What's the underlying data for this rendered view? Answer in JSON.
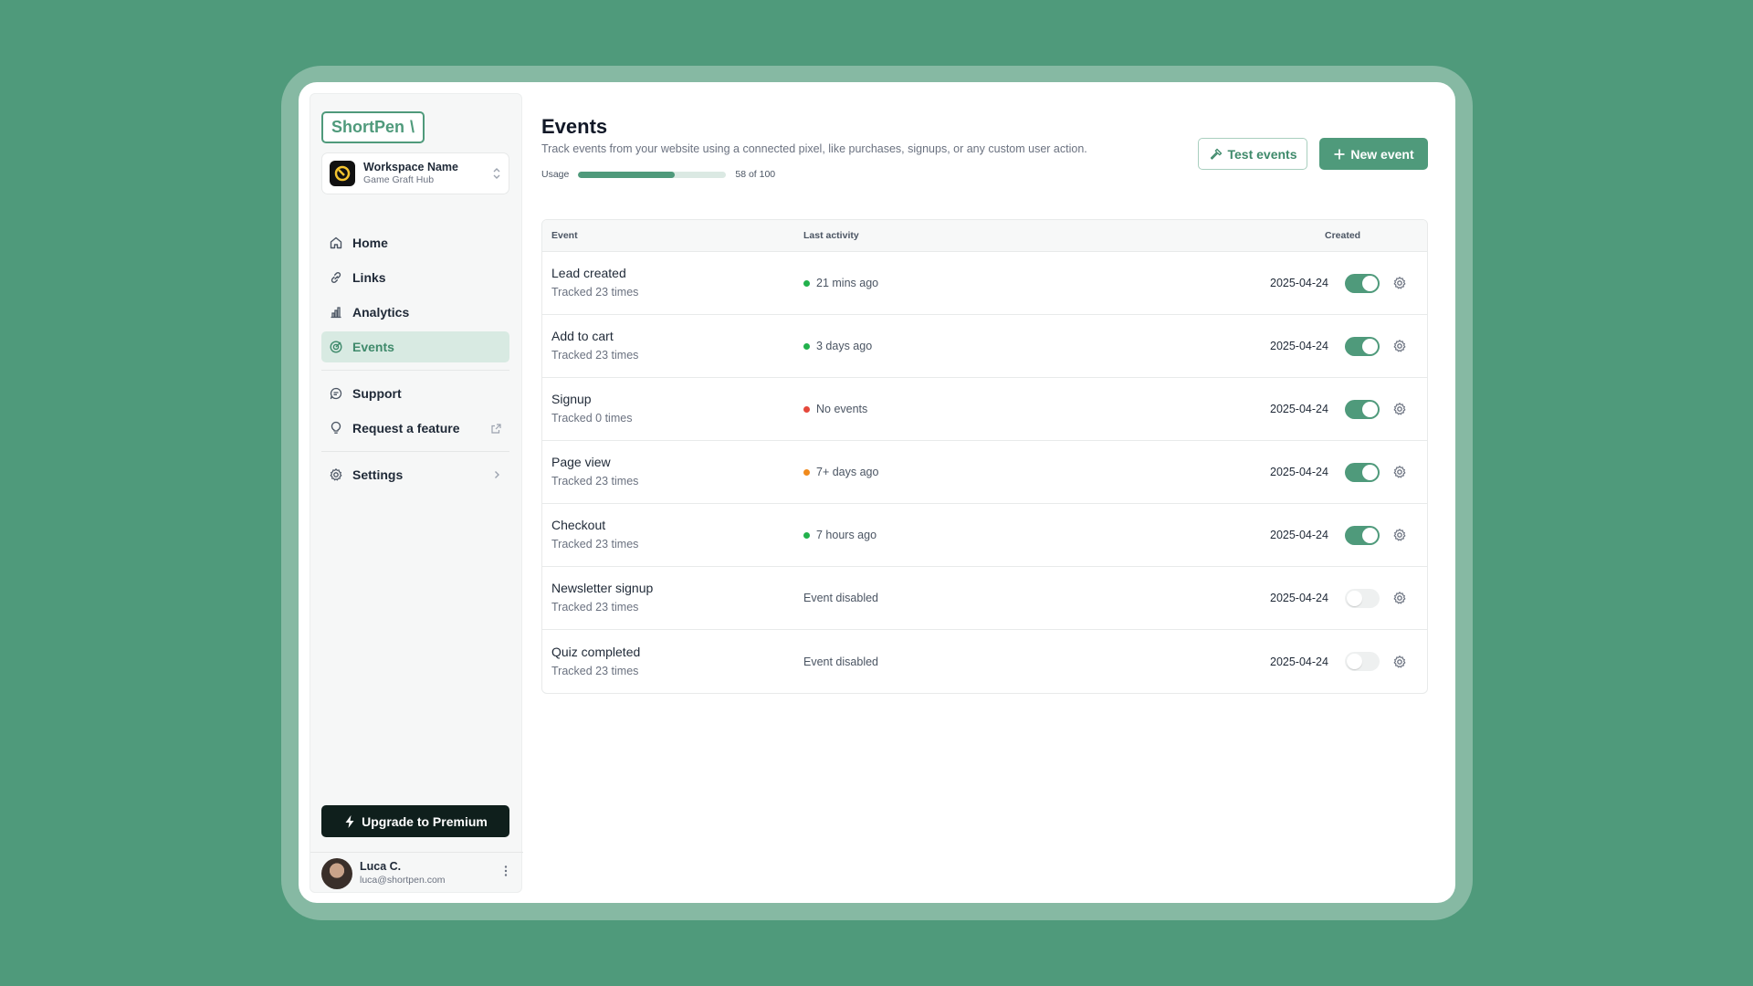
{
  "brand": {
    "logo_text": "ShortPen",
    "logo_mark": "\\"
  },
  "workspace": {
    "name": "Workspace Name",
    "subtitle": "Game Graft Hub"
  },
  "nav": {
    "home": "Home",
    "links": "Links",
    "analytics": "Analytics",
    "events": "Events",
    "support": "Support",
    "request_feature": "Request a feature",
    "settings": "Settings"
  },
  "upgrade": {
    "label": "Upgrade to Premium"
  },
  "user": {
    "name": "Luca C.",
    "email": "luca@shortpen.com"
  },
  "page": {
    "title": "Events",
    "subtitle": "Track events from your website using a connected pixel, like purchases, signups, or any custom user action.",
    "usage_label": "Usage",
    "usage_text": "58 of 100",
    "usage_fraction": 0.65
  },
  "actions": {
    "test_events": "Test events",
    "new_event": "New event"
  },
  "table": {
    "headers": {
      "event": "Event",
      "last_activity": "Last activity",
      "created": "Created"
    },
    "rows": [
      {
        "name": "Lead created",
        "tracked": "Tracked 23 times",
        "activity": "21 mins ago",
        "status_color": "#22b14c",
        "created": "2025-04-24",
        "enabled": true
      },
      {
        "name": "Add to cart",
        "tracked": "Tracked 23 times",
        "activity": "3 days ago",
        "status_color": "#22b14c",
        "created": "2025-04-24",
        "enabled": true
      },
      {
        "name": "Signup",
        "tracked": "Tracked 0 times",
        "activity": "No events",
        "status_color": "#e5483b",
        "created": "2025-04-24",
        "enabled": true
      },
      {
        "name": "Page view",
        "tracked": "Tracked 23 times",
        "activity": "7+ days ago",
        "status_color": "#f08a1c",
        "created": "2025-04-24",
        "enabled": true
      },
      {
        "name": "Checkout",
        "tracked": "Tracked 23 times",
        "activity": "7 hours ago",
        "status_color": "#22b14c",
        "created": "2025-04-24",
        "enabled": true
      },
      {
        "name": "Newsletter signup",
        "tracked": "Tracked 23 times",
        "activity": "Event disabled",
        "status_color": "",
        "created": "2025-04-24",
        "enabled": false
      },
      {
        "name": "Quiz completed",
        "tracked": "Tracked 23 times",
        "activity": "Event disabled",
        "status_color": "",
        "created": "2025-04-24",
        "enabled": false
      }
    ]
  },
  "colors": {
    "accent": "#4f9a7b",
    "background": "#4f9a7b",
    "active_nav_bg": "#d8eae2",
    "upgrade_bg": "#0f1f1c"
  },
  "icons": [
    "home-icon",
    "link-icon",
    "analytics-icon",
    "target-icon",
    "chat-icon",
    "lightbulb-icon",
    "external-link-icon",
    "gear-icon",
    "chevron-right-icon",
    "hammer-icon",
    "plus-icon",
    "bolt-icon",
    "kebab-icon",
    "updown-icon"
  ]
}
